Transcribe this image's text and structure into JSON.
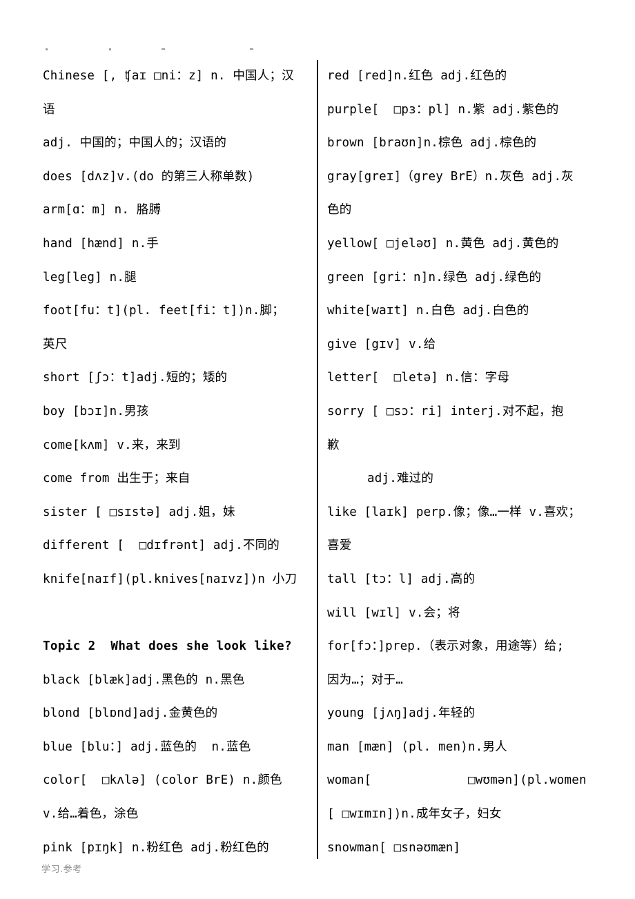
{
  "document": {
    "type": "vocabulary-word-list",
    "background_color": "#ffffff",
    "text_color": "#000000",
    "divider_color": "#1a1a1a",
    "watermark": "学习.参考",
    "watermark_color": "#8d8d8d"
  },
  "left_column": {
    "entries": [
      {
        "kind": "entry",
        "text": "Chinese [, ʧaɪ □ni：z] n. 中国人；汉"
      },
      {
        "kind": "entry",
        "text": "语"
      },
      {
        "kind": "entry",
        "text": "adj. 中国的；中国人的；汉语的"
      },
      {
        "kind": "entry",
        "text": "does [dʌz]v.(do 的第三人称单数)"
      },
      {
        "kind": "entry",
        "text": "arm[ɑ：m] n. 胳膊"
      },
      {
        "kind": "entry",
        "text": "hand [hænd] n.手"
      },
      {
        "kind": "entry",
        "text": "leg[leg] n.腿"
      },
      {
        "kind": "entry",
        "text": "foot[fu：t](pl. feet[fi：t])n.脚；"
      },
      {
        "kind": "entry",
        "text": "英尺"
      },
      {
        "kind": "entry",
        "text": "short [ʃɔ：t]adj.短的；矮的"
      },
      {
        "kind": "entry",
        "text": "boy [bɔɪ]n.男孩"
      },
      {
        "kind": "entry",
        "text": "come[kʌm] v.来，来到"
      },
      {
        "kind": "entry",
        "text": "come from 出生于；来自"
      },
      {
        "kind": "entry",
        "text": "sister [ □sɪstə] adj.姐，妹"
      },
      {
        "kind": "entry",
        "text": "different [  □dɪfrənt] adj.不同的"
      },
      {
        "kind": "entry",
        "text": "knife[naɪf](pl.knives[naɪvz])n 小刀"
      },
      {
        "kind": "spacer",
        "text": ""
      },
      {
        "kind": "heading",
        "text": "Topic 2  What does she look like?"
      },
      {
        "kind": "entry",
        "text": "black [blæk]adj.黑色的 n.黑色"
      },
      {
        "kind": "entry",
        "text": "blond [blɒnd]adj.金黄色的"
      },
      {
        "kind": "entry",
        "text": "blue [blu：] adj.蓝色的  n.蓝色"
      },
      {
        "kind": "entry",
        "text": "color[  □kʌlə] (color BrE) n.颜色"
      },
      {
        "kind": "entry",
        "text": "v.给…着色，涂色"
      },
      {
        "kind": "entry",
        "text": "pink [pɪŋk] n.粉红色 adj.粉红色的"
      }
    ]
  },
  "right_column": {
    "entries": [
      {
        "kind": "entry",
        "text": "red [red]n.红色 adj.红色的"
      },
      {
        "kind": "entry",
        "text": "purple[  □pɜ：pl] n.紫 adj.紫色的"
      },
      {
        "kind": "entry",
        "text": "brown [braʊn]n.棕色 adj.棕色的"
      },
      {
        "kind": "entry",
        "text": "gray[greɪ]（grey BrE）n.灰色 adj.灰"
      },
      {
        "kind": "entry",
        "text": "色的"
      },
      {
        "kind": "entry",
        "text": "yellow[ □jeləʊ] n.黄色 adj.黄色的"
      },
      {
        "kind": "entry",
        "text": "green [gri：n]n.绿色 adj.绿色的"
      },
      {
        "kind": "entry",
        "text": "white[waɪt] n.白色 adj.白色的"
      },
      {
        "kind": "entry",
        "text": "give [gɪv] v.给"
      },
      {
        "kind": "entry",
        "text": "letter[  □letə] n.信：字母"
      },
      {
        "kind": "entry",
        "text": "sorry [ □sɔ：ri] interj.对不起，抱"
      },
      {
        "kind": "entry",
        "text": "歉"
      },
      {
        "kind": "indent",
        "text": "adj.难过的"
      },
      {
        "kind": "entry",
        "text": "like [laɪk] perp.像；像…一样 v.喜欢；"
      },
      {
        "kind": "entry",
        "text": "喜爱"
      },
      {
        "kind": "entry",
        "text": "tall [tɔ：l] adj.高的"
      },
      {
        "kind": "entry",
        "text": "will [wɪl] v.会；将"
      },
      {
        "kind": "entry",
        "text": "for[fɔ：]prep.（表示对象，用途等）给;"
      },
      {
        "kind": "entry",
        "text": "因为…；对于…"
      },
      {
        "kind": "entry",
        "text": "young [jʌŋ]adj.年轻的"
      },
      {
        "kind": "entry",
        "text": "man [mæn] (pl. men)n.男人"
      },
      {
        "kind": "entry",
        "text": "woman[             □wʊmən](pl.women"
      },
      {
        "kind": "entry",
        "text": "[ □wɪmɪn])n.成年女子，妇女"
      },
      {
        "kind": "entry",
        "text": "snowman[ □snəʊmæn]"
      }
    ]
  }
}
